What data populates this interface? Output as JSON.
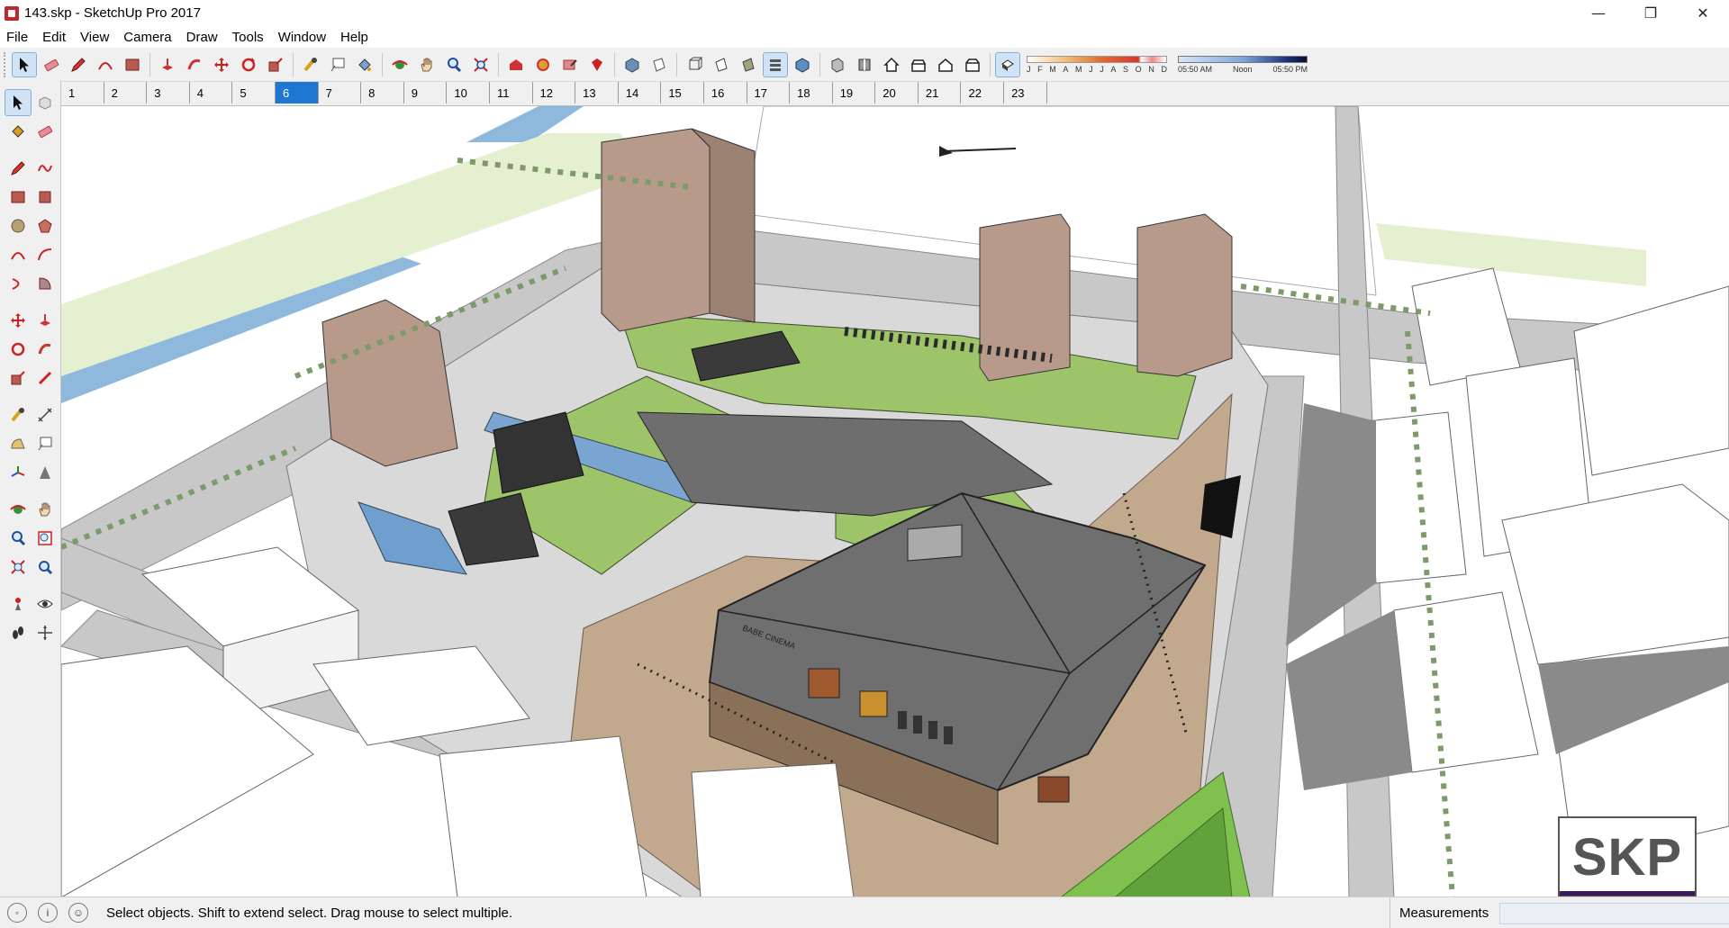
{
  "window": {
    "title": "143.skp - SketchUp Pro 2017",
    "controls": [
      "—",
      "❐",
      "✕"
    ]
  },
  "menu": [
    "File",
    "Edit",
    "View",
    "Camera",
    "Draw",
    "Tools",
    "Window",
    "Help"
  ],
  "toolbar": {
    "shadow_months": [
      "J",
      "F",
      "M",
      "A",
      "M",
      "J",
      "J",
      "A",
      "S",
      "O",
      "N",
      "D"
    ],
    "shadow_times": [
      "05:50 AM",
      "Noon",
      "05:50 PM"
    ]
  },
  "scenes": {
    "tabs": [
      "1",
      "2",
      "3",
      "4",
      "5",
      "6",
      "7",
      "8",
      "9",
      "10",
      "11",
      "12",
      "13",
      "14",
      "15",
      "16",
      "17",
      "18",
      "19",
      "20",
      "21",
      "22",
      "23"
    ],
    "active": "6"
  },
  "viewport": {
    "logo_text": "SKP",
    "sign_text": "BABE CINEMA"
  },
  "status": {
    "message": "Select objects. Shift to extend select. Drag mouse to select multiple.",
    "measurements_label": "Measurements",
    "measurements_value": ""
  },
  "colors": {
    "active_tab": "#1e78d2",
    "grass": "#9ec46a",
    "water": "#8fb9dc",
    "roof": "#6f6f6f",
    "tower": "#b89a8a"
  }
}
